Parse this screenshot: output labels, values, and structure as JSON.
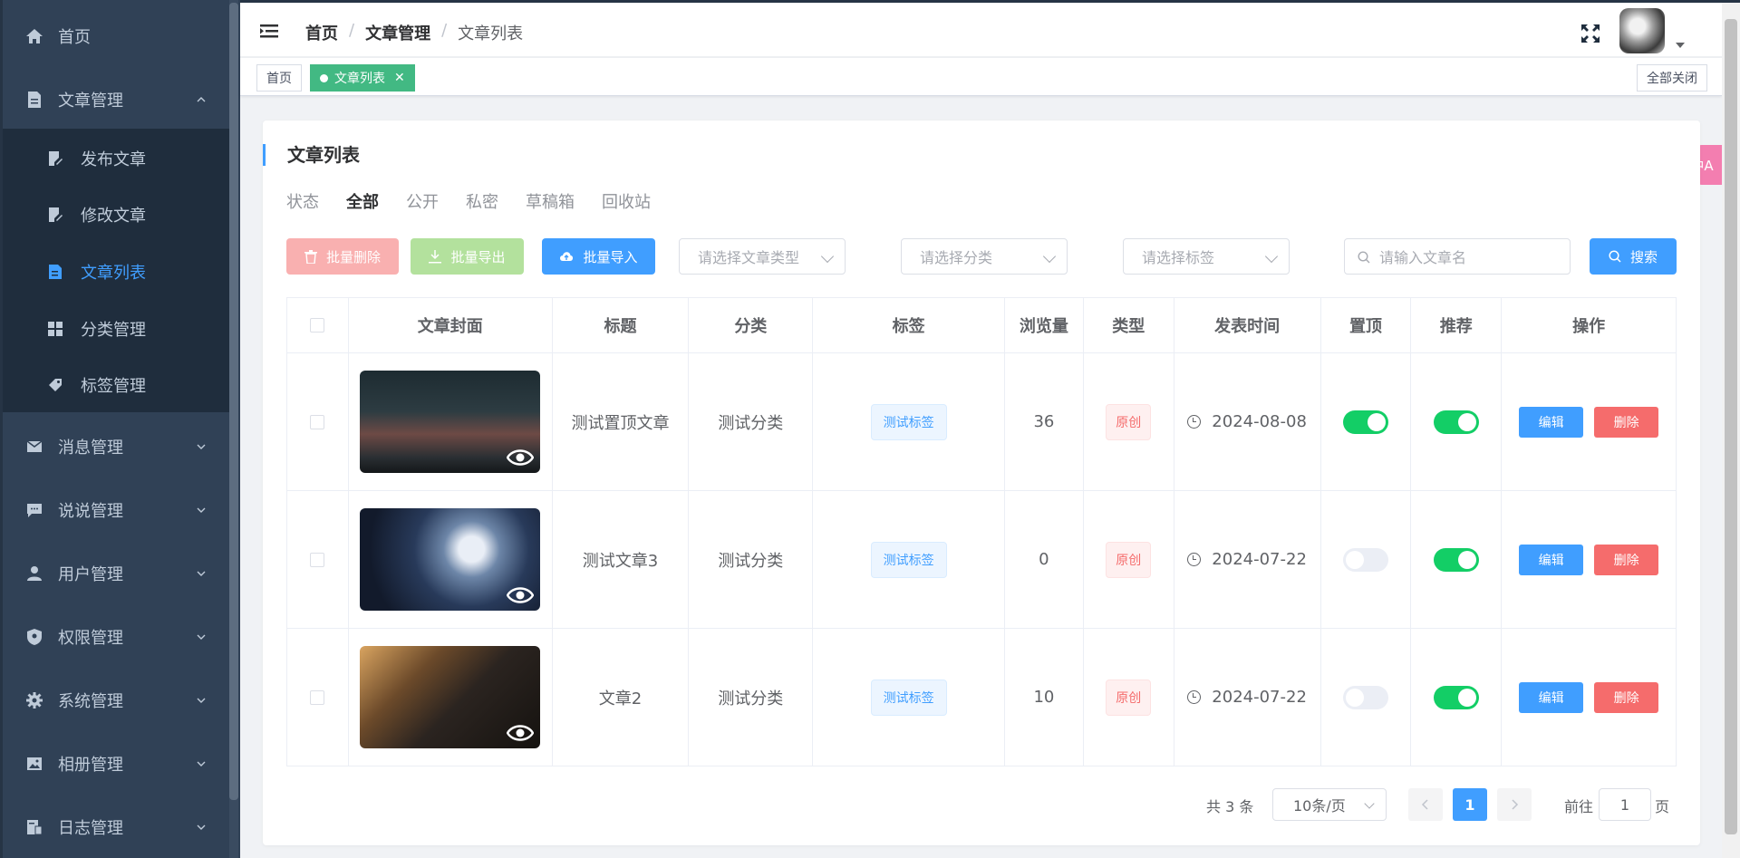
{
  "sidebar": {
    "items": [
      {
        "label": "首页",
        "icon": "home-icon"
      },
      {
        "label": "文章管理",
        "icon": "document-icon",
        "expanded": true
      },
      {
        "label": "消息管理",
        "icon": "mail-icon"
      },
      {
        "label": "说说管理",
        "icon": "chat-icon"
      },
      {
        "label": "用户管理",
        "icon": "user-icon"
      },
      {
        "label": "权限管理",
        "icon": "shield-icon"
      },
      {
        "label": "系统管理",
        "icon": "gear-icon"
      },
      {
        "label": "相册管理",
        "icon": "image-icon"
      },
      {
        "label": "日志管理",
        "icon": "log-icon"
      }
    ],
    "sub_items": [
      {
        "label": "发布文章",
        "icon": "edit-icon"
      },
      {
        "label": "修改文章",
        "icon": "edit-icon"
      },
      {
        "label": "文章列表",
        "icon": "list-icon",
        "active": true
      },
      {
        "label": "分类管理",
        "icon": "grid-icon"
      },
      {
        "label": "标签管理",
        "icon": "tag-icon"
      }
    ]
  },
  "header": {
    "breadcrumb": [
      "首页",
      "文章管理",
      "文章列表"
    ]
  },
  "tags": {
    "home": "首页",
    "current": "文章列表",
    "close_all": "全部关闭"
  },
  "translate_label": "中A",
  "card": {
    "title": "文章列表",
    "status_label": "状态",
    "status_tabs": [
      "全部",
      "公开",
      "私密",
      "草稿箱",
      "回收站"
    ],
    "active_status": "全部",
    "buttons": {
      "batch_delete": "批量删除",
      "batch_export": "批量导出",
      "batch_import": "批量导入",
      "search": "搜索"
    },
    "filters": {
      "type_placeholder": "请选择文章类型",
      "category_placeholder": "请选择分类",
      "tag_placeholder": "请选择标签",
      "name_placeholder": "请输入文章名"
    }
  },
  "table": {
    "headers": [
      "文章封面",
      "标题",
      "分类",
      "标签",
      "浏览量",
      "类型",
      "发表时间",
      "置顶",
      "推荐",
      "操作"
    ],
    "rows": [
      {
        "title": "测试置顶文章",
        "category": "测试分类",
        "tag": "测试标签",
        "views": "36",
        "type": "原创",
        "date": "2024-08-08",
        "top": true,
        "recommend": true
      },
      {
        "title": "测试文章3",
        "category": "测试分类",
        "tag": "测试标签",
        "views": "0",
        "type": "原创",
        "date": "2024-07-22",
        "top": false,
        "recommend": true
      },
      {
        "title": "文章2",
        "category": "测试分类",
        "tag": "测试标签",
        "views": "10",
        "type": "原创",
        "date": "2024-07-22",
        "top": false,
        "recommend": true
      }
    ],
    "edit_label": "编辑",
    "delete_label": "删除"
  },
  "pagination": {
    "total": "共 3 条",
    "page_size": "10条/页",
    "current_page": "1",
    "goto_label": "前往",
    "goto_value": "1",
    "page_suffix": "页"
  },
  "colors": {
    "sidebar_bg": "#304156",
    "submenu_bg": "#1f2d3d",
    "primary": "#409eff",
    "active_tag": "#42b983",
    "switch_on": "#13ce66",
    "danger": "#f56c6c"
  }
}
